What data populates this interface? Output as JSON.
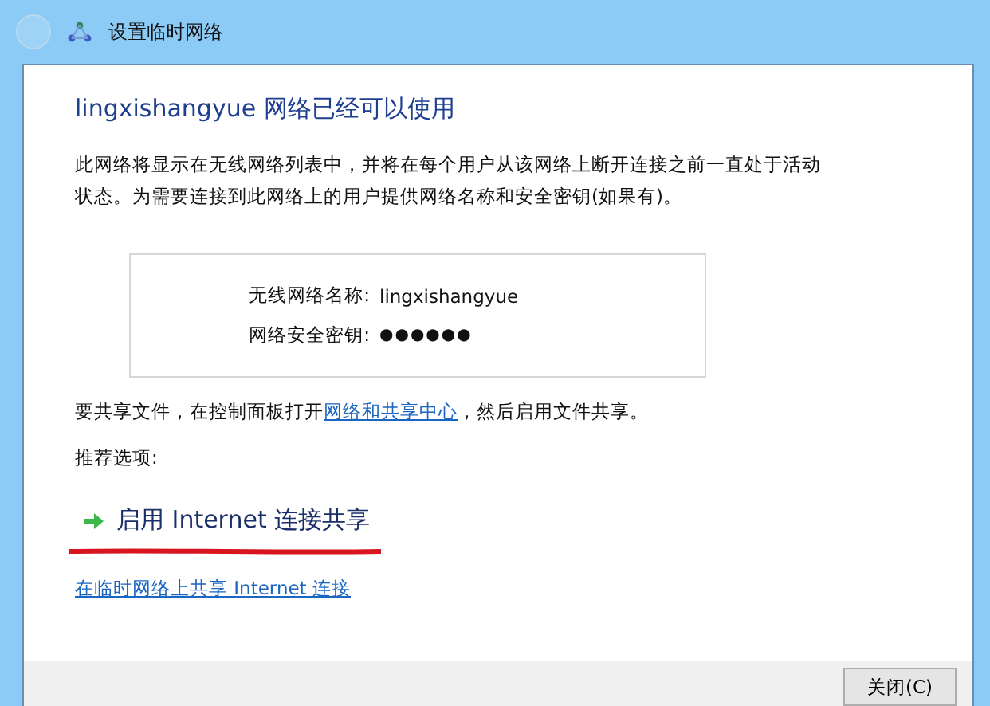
{
  "window": {
    "title": "设置临时网络"
  },
  "heading": "lingxishangyue 网络已经可以使用",
  "description": "此网络将显示在无线网络列表中，并将在每个用户从该网络上断开连接之前一直处于活动状态。为需要连接到此网络上的用户提供网络名称和安全密钥(如果有)。",
  "details": [
    {
      "label": "无线网络名称:",
      "value": "lingxishangyue",
      "kind": "name"
    },
    {
      "label": "网络安全密钥:",
      "value": "●●●●●●",
      "kind": "key"
    }
  ],
  "sharing_note": {
    "before": "要共享文件，在控制面板打开",
    "link": "网络和共享中心",
    "after": "，然后启用文件共享。"
  },
  "recommended_label": "推荐选项:",
  "command_link": "启用 Internet 连接共享",
  "share_link": "在临时网络上共享 Internet 连接",
  "buttons": [
    "关闭(C)"
  ]
}
